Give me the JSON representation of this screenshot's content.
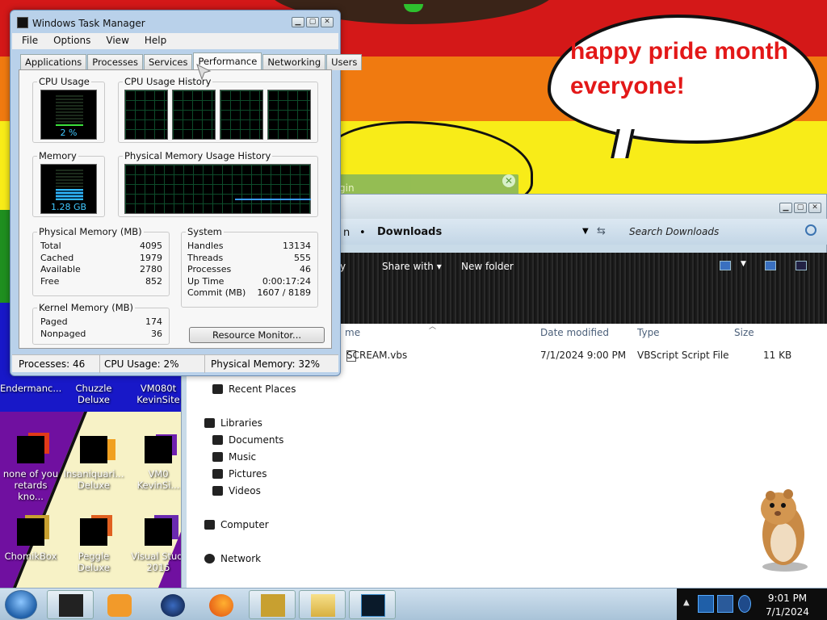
{
  "bubble": {
    "text_line1": "happy pride month",
    "text_line2": "everyone!"
  },
  "desktop_icons": [
    {
      "label": "Endermanc...",
      "label2": ""
    },
    {
      "label": "Chuzzle",
      "label2": "Deluxe"
    },
    {
      "label": "VM080t",
      "label2": "KevinSite"
    },
    {
      "label": "none of you",
      "label2": "retards kno..."
    },
    {
      "label": "Insaniquari...",
      "label2": "Deluxe"
    },
    {
      "label": "VM0",
      "label2": "KevinSi..."
    },
    {
      "label": "ChomikBox",
      "label2": ""
    },
    {
      "label": "Peggle Deluxe",
      "label2": ""
    },
    {
      "label": "Visual Studi",
      "label2": "2015"
    }
  ],
  "task_manager": {
    "title": "Windows Task Manager",
    "menu": [
      "File",
      "Options",
      "View",
      "Help"
    ],
    "tabs": [
      "Applications",
      "Processes",
      "Services",
      "Performance",
      "Networking",
      "Users"
    ],
    "active_tab": "Performance",
    "cpu_usage_label": "CPU Usage",
    "cpu_usage_value": "2 %",
    "cpu_history_label": "CPU Usage History",
    "memory_label": "Memory",
    "memory_value": "1.28 GB",
    "mem_history_label": "Physical Memory Usage History",
    "physical_memory": {
      "label": "Physical Memory (MB)",
      "rows": [
        {
          "name": "Total",
          "value": "4095"
        },
        {
          "name": "Cached",
          "value": "1979"
        },
        {
          "name": "Available",
          "value": "2780"
        },
        {
          "name": "Free",
          "value": "852"
        }
      ]
    },
    "kernel_memory": {
      "label": "Kernel Memory (MB)",
      "rows": [
        {
          "name": "Paged",
          "value": "174"
        },
        {
          "name": "Nonpaged",
          "value": "36"
        }
      ]
    },
    "system": {
      "label": "System",
      "rows": [
        {
          "name": "Handles",
          "value": "13134"
        },
        {
          "name": "Threads",
          "value": "555"
        },
        {
          "name": "Processes",
          "value": "46"
        },
        {
          "name": "Up Time",
          "value": "0:00:17:24"
        },
        {
          "name": "Commit (MB)",
          "value": "1607 / 8189"
        }
      ]
    },
    "resource_monitor_button": "Resource Monitor...",
    "status": {
      "processes": "Processes: 46",
      "cpu": "CPU Usage: 2%",
      "memory": "Physical Memory: 32%"
    }
  },
  "explorer": {
    "breadcrumb_partial": "n",
    "breadcrumb_current": "Downloads",
    "search_placeholder": "Search Downloads",
    "toolbar": {
      "share_with": "Share with",
      "new_folder": "New folder",
      "partial": "y"
    },
    "columns": {
      "name": "me",
      "date": "Date modified",
      "type": "Type",
      "size": "Size"
    },
    "files": [
      {
        "name": "SCREAM.vbs",
        "date": "7/1/2024 9:00 PM",
        "type": "VBScript Script File",
        "size": "11 KB"
      }
    ],
    "nav": {
      "recent_places": "Recent Places",
      "libraries": "Libraries",
      "documents": "Documents",
      "music": "Music",
      "pictures": "Pictures",
      "videos": "Videos",
      "computer": "Computer",
      "network": "Network"
    }
  },
  "ghost_dialog": {
    "partial_text": "gin"
  },
  "taskbar": {
    "time": "9:01 PM",
    "date": "7/1/2024"
  }
}
